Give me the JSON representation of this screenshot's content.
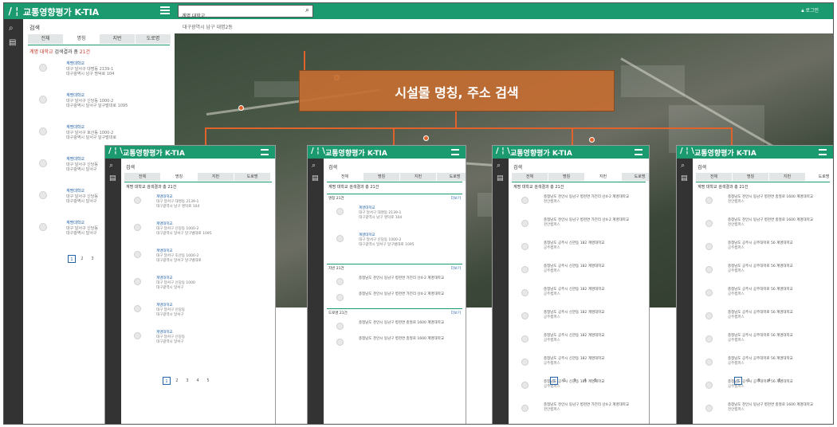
{
  "app": {
    "logo": "/ ¦ \\",
    "title": "교통영향평가 K-TIA",
    "search_value": "계명 대학교",
    "login_label": "로그인"
  },
  "side": {
    "header": "검색",
    "tabs": [
      "전체",
      "명칭",
      "지번",
      "도로명"
    ],
    "result_keyword": "계명 대학교",
    "result_label": "검색결과 총",
    "result_count": "21건",
    "items": [
      {
        "name": "계명대학교",
        "addr1": "대구 달서구 대명동 2139-1",
        "addr2": "대구광역시 남구 명덕로 104"
      },
      {
        "name": "계명대학교",
        "addr1": "대구 달서구 신당동 1000-2",
        "addr2": "대구광역시 달서구 달구벌대로 1095"
      },
      {
        "name": "계명대학교",
        "addr1": "대구 달서구 호산동 1000-2",
        "addr2": "대구광역시 달서구 달구벌대로"
      },
      {
        "name": "계명대학교",
        "addr1": "대구 달서구 신당동",
        "addr2": "대구광역시 달서구"
      },
      {
        "name": "계명대학교",
        "addr1": "대구 달서구 신당동",
        "addr2": "대구광역시 달서구"
      },
      {
        "name": "계명대학교",
        "addr1": "대구 달서구 신당동",
        "addr2": "대구광역시 달서구"
      }
    ],
    "pages": [
      "1",
      "2",
      "3"
    ]
  },
  "map": {
    "breadcrumb": "대구광역시 남구 대명2동",
    "callout": "시설물 명칭, 주소 검색"
  },
  "panels": [
    {
      "title": "교통영향평가 K-TIA",
      "header": "검색",
      "active_tab": 1,
      "result": "계명 대학교 검색결과 총 21건",
      "items": [
        {
          "t1": "계명대학교",
          "t2": "대구 달서구 대명동 2139-1",
          "t3": "대구광역시 남구 명덕로 104"
        },
        {
          "t1": "계명대학교",
          "t2": "대구 달서구 신당동 1000-2",
          "t3": "대구광역시 달서구 달구벌대로 1095"
        },
        {
          "t1": "계명대학교",
          "t2": "대구 달서구 호산동 1000-2",
          "t3": "대구광역시 달서구 달구벌대로"
        },
        {
          "t1": "계명대학교",
          "t2": "대구 달서구 신당동 1000",
          "t3": "대구광역시 달서구"
        },
        {
          "t1": "계명대학교",
          "t2": "대구 달서구 신당동",
          "t3": "대구광역시 달서구"
        },
        {
          "t1": "계명대학교",
          "t2": "대구 달서구 신당동",
          "t3": "대구광역시 달서구"
        }
      ],
      "pages": [
        "1",
        "2",
        "3",
        "4",
        "5"
      ]
    },
    {
      "title": "교통영향평가 K-TIA",
      "header": "검색",
      "active_tab": 0,
      "result": "계명 대학교 검색결과 총 21건",
      "sections": [
        {
          "label": "명칭 21건",
          "more": "더보기"
        },
        {
          "label": "지번 21건",
          "more": "더보기"
        },
        {
          "label": "도로명 21건",
          "more": "더보기"
        }
      ],
      "items_a": [
        {
          "t1": "계명대학교",
          "t2": "대구 달서구 대명동 2139-1",
          "t3": "대구광역시 남구 명덕로 104"
        },
        {
          "t1": "계명대학교",
          "t2": "대구 달서구 신당동 1000-2",
          "t3": "대구광역시 달서구 달구벌대로 1095"
        }
      ],
      "items_b": [
        {
          "t1": "충청남도 천안시 동남구 병천면 가전리 산4-2 계명대학교",
          "t2": "",
          "t3": ""
        },
        {
          "t1": "충청남도 천안시 동남구 병천면 가전리 산4-2 계명대학교",
          "t2": "",
          "t3": ""
        }
      ],
      "items_c": [
        {
          "t1": "충청남도 천안시 동남구 병천면 충절로 1600 계명대학교",
          "t2": "",
          "t3": ""
        },
        {
          "t1": "충청남도 천안시 동남구 병천면 충절로 1600 계명대학교",
          "t2": "",
          "t3": ""
        }
      ]
    },
    {
      "title": "교통영향평가 K-TIA",
      "header": "검색",
      "active_tab": 2,
      "result": "계명 대학교 검색결과 총 21건",
      "items": [
        {
          "t1": "충청남도 천안시 동남구 병천면 가전리 산4-2 계명대학교",
          "t2": "천안캠퍼스",
          "t3": ""
        },
        {
          "t1": "충청남도 천안시 동남구 병천면 가전리 산4-2 계명대학교",
          "t2": "천안캠퍼스",
          "t3": ""
        },
        {
          "t1": "충청남도 공주시 신관동 182 계명대학교",
          "t2": "공주캠퍼스",
          "t3": ""
        },
        {
          "t1": "충청남도 공주시 신관동 182 계명대학교",
          "t2": "공주캠퍼스",
          "t3": ""
        },
        {
          "t1": "충청남도 공주시 신관동 182 계명대학교",
          "t2": "공주캠퍼스",
          "t3": ""
        },
        {
          "t1": "충청남도 공주시 신관동 182 계명대학교",
          "t2": "공주캠퍼스",
          "t3": ""
        },
        {
          "t1": "충청남도 공주시 신관동 182 계명대학교",
          "t2": "공주캠퍼스",
          "t3": ""
        },
        {
          "t1": "충청남도 공주시 신관동 182 계명대학교",
          "t2": "공주캠퍼스",
          "t3": ""
        },
        {
          "t1": "충청남도 공주시 신관동 182 계명대학교",
          "t2": "공주캠퍼스",
          "t3": ""
        },
        {
          "t1": "충청남도 천안시 동남구 병천면 가전리 산4-2 계명대학교",
          "t2": "천안캠퍼스",
          "t3": ""
        }
      ],
      "pages": [
        "1",
        "2",
        "3",
        "4",
        "5"
      ]
    },
    {
      "title": "교통영향평가 K-TIA",
      "header": "검색",
      "active_tab": 3,
      "result": "계명 대학교 검색결과 총 21건",
      "items": [
        {
          "t1": "충청남도 천안시 동남구 병천면 충절로 1600 계명대학교",
          "t2": "천안캠퍼스",
          "t3": ""
        },
        {
          "t1": "충청남도 천안시 동남구 병천면 충절로 1600 계명대학교",
          "t2": "천안캠퍼스",
          "t3": ""
        },
        {
          "t1": "충청남도 공주시 공주대학로 56 계명대학교",
          "t2": "공주캠퍼스",
          "t3": ""
        },
        {
          "t1": "충청남도 공주시 공주대학로 56 계명대학교",
          "t2": "공주캠퍼스",
          "t3": ""
        },
        {
          "t1": "충청남도 공주시 공주대학로 56 계명대학교",
          "t2": "공주캠퍼스",
          "t3": ""
        },
        {
          "t1": "충청남도 공주시 공주대학로 56 계명대학교",
          "t2": "공주캠퍼스",
          "t3": ""
        },
        {
          "t1": "충청남도 공주시 공주대학로 56 계명대학교",
          "t2": "공주캠퍼스",
          "t3": ""
        },
        {
          "t1": "충청남도 공주시 공주대학로 56 계명대학교",
          "t2": "공주캠퍼스",
          "t3": ""
        },
        {
          "t1": "충청남도 공주시 공주대학로 56 계명대학교",
          "t2": "공주캠퍼스",
          "t3": ""
        },
        {
          "t1": "충청남도 천안시 동남구 병천면 충절로 1600 계명대학교",
          "t2": "천안캠퍼스",
          "t3": ""
        }
      ],
      "pages": [
        "1",
        "2",
        "3",
        "4",
        "5"
      ]
    }
  ],
  "colors": {
    "brand": "#1a9a6e",
    "accent": "#e0632c",
    "link": "#2563a8"
  },
  "icons": [
    "search-icon",
    "memo-icon",
    "menu-icon",
    "lock-icon"
  ]
}
